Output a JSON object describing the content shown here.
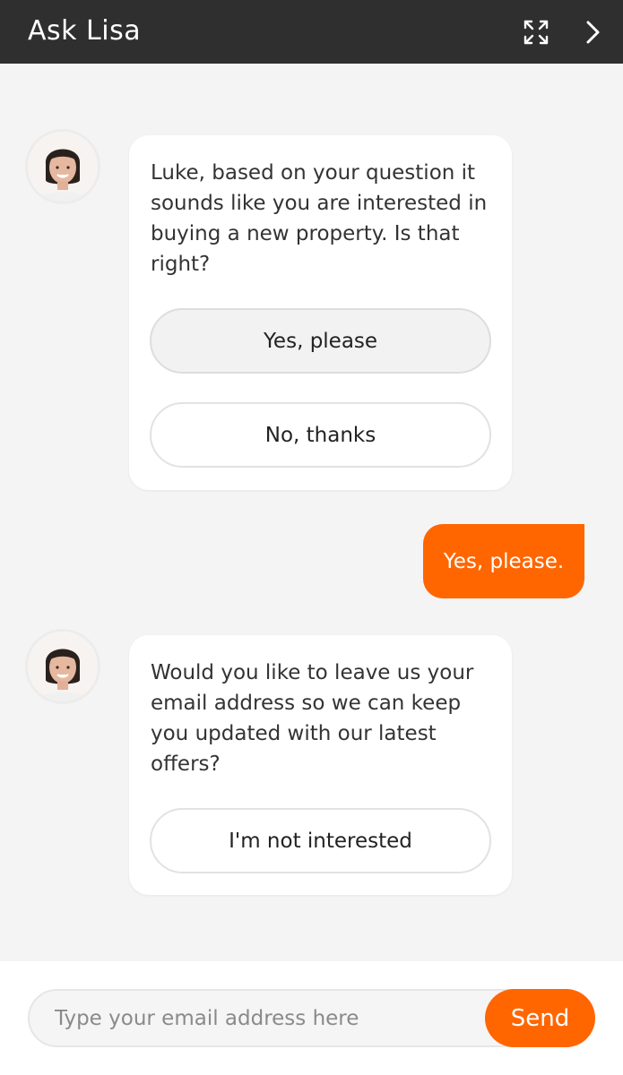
{
  "header": {
    "title": "Ask Lisa",
    "expand_icon": "expand-arrows-icon",
    "next_icon": "chevron-right-icon"
  },
  "messages": [
    {
      "from": "bot",
      "text": "Luke, based on your question it sounds like you are interested in buying a new property. Is that right?",
      "options": [
        "Yes, please",
        "No, thanks"
      ],
      "selected_option": "Yes, please"
    },
    {
      "from": "user",
      "text": "Yes, please."
    },
    {
      "from": "bot",
      "text": "Would you like to leave us your email address so we can keep you updated with our latest offers?",
      "options": [
        "I'm not interested"
      ]
    }
  ],
  "composer": {
    "placeholder": "Type your email address here",
    "value": "",
    "send_label": "Send"
  },
  "colors": {
    "header_bg": "#2f2f2f",
    "accent": "#ff6600",
    "chat_bg": "#f4f4f4"
  }
}
